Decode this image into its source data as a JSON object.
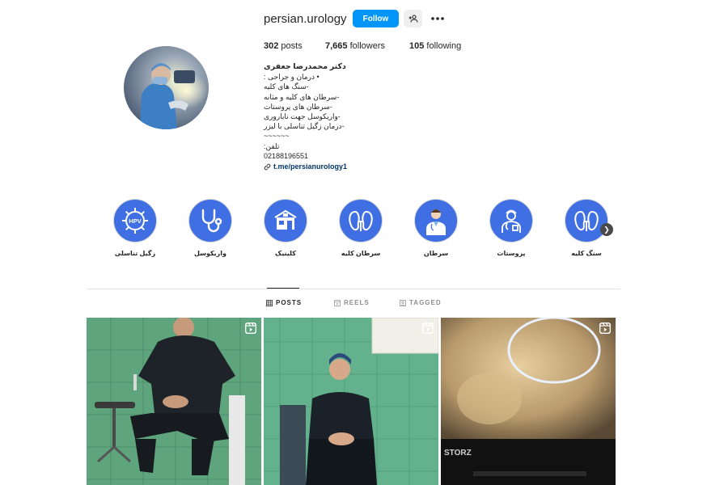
{
  "profile": {
    "username": "persian.urology",
    "follow_label": "Follow"
  },
  "stats": {
    "posts_count": "302",
    "posts_label": " posts",
    "followers_count": "7,665",
    "followers_label": " followers",
    "following_count": "105",
    "following_label": " following"
  },
  "bio": {
    "name": "دکتر محمدرضا جعفری",
    "lines": [
      "• درمان و جراحی :",
      "-سنگ های کلیه",
      "-سرطان های کلیه و مثانه",
      "-سرطان های پروستات",
      "-واریکوسل جهت ناباروری",
      "-درمان زگیل تناسلی با لیزر",
      "~~~~~~",
      "تلفن:",
      "02188196551"
    ],
    "link": "t.me/persianurology1"
  },
  "highlights": [
    {
      "label": "زگیل تناسلی",
      "icon": "hpv-virus-icon"
    },
    {
      "label": "واریکوسل",
      "icon": "stethoscope-icon"
    },
    {
      "label": "کلینیک",
      "icon": "clinic-building-icon"
    },
    {
      "label": "سرطان کلیه",
      "icon": "kidney-icon"
    },
    {
      "label": "سرطان",
      "icon": "doctor-icon"
    },
    {
      "label": "پروستات",
      "icon": "nurse-icon"
    },
    {
      "label": "سنگ کلیه",
      "icon": "kidney-icon"
    }
  ],
  "tabs": [
    {
      "label": "POSTS",
      "icon": "grid-icon",
      "active": true
    },
    {
      "label": "REELS",
      "icon": "reels-icon",
      "active": false
    },
    {
      "label": "TAGGED",
      "icon": "tagged-icon",
      "active": false
    }
  ],
  "posts": [
    {
      "type": "reel",
      "icon": "reel-icon"
    },
    {
      "type": "reel",
      "icon": "reel-icon"
    },
    {
      "type": "reel",
      "icon": "reel-icon",
      "overlay_text": "STORZ"
    }
  ],
  "colors": {
    "primary_blue": "#0095f6",
    "highlight_blue": "#3f6fe2",
    "link": "#00376b",
    "text": "#262626",
    "muted": "#8e8e8e"
  }
}
